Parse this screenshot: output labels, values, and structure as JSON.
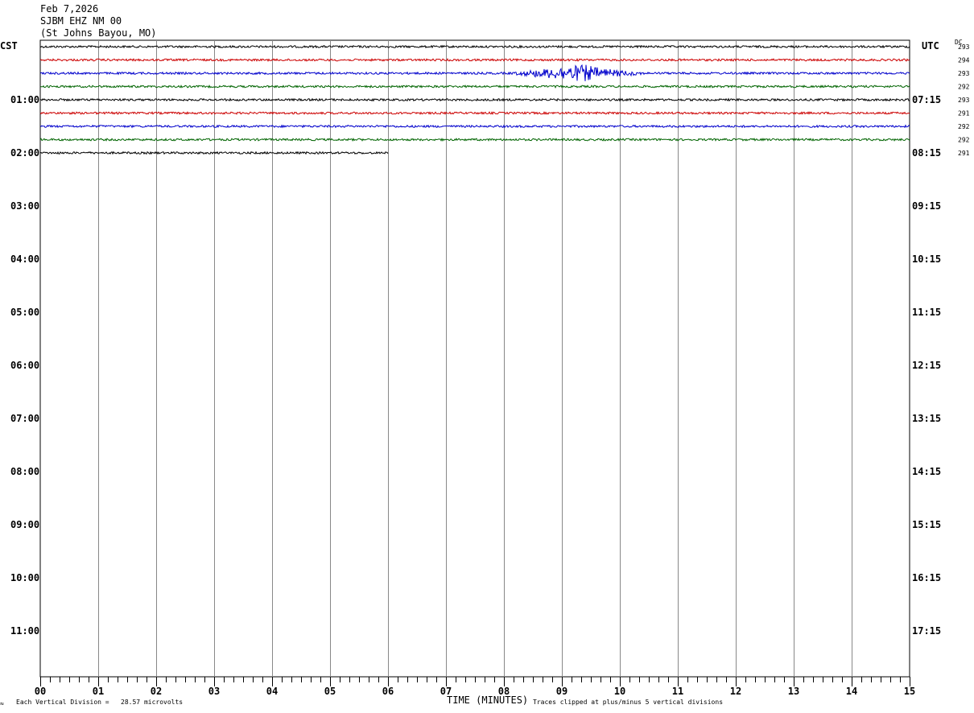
{
  "header": {
    "date": "Feb 7,2026",
    "station": "SJBM EHZ NM 00",
    "location": "(St Johns Bayou, MO)"
  },
  "left_timezone": "CST",
  "right_timezone": "UTC",
  "dc_label": "DC",
  "footer": {
    "vertical_division": "Each Vertical Division =   28.57 microvolts",
    "clip_note": "Traces clipped at plus/minus 5 vertical divisions",
    "corner_mark": "≈"
  },
  "chart_data": {
    "type": "line",
    "title": "",
    "xlabel": "TIME (MINUTES)",
    "ylabel": "",
    "xlim": [
      0,
      15
    ],
    "x_ticks": [
      "00",
      "01",
      "02",
      "03",
      "04",
      "05",
      "06",
      "07",
      "08",
      "09",
      "10",
      "11",
      "12",
      "13",
      "14",
      "15"
    ],
    "rows_per_hour": 4,
    "total_rows": 48,
    "left_hour_labels": [
      "01:00",
      "02:00",
      "03:00",
      "04:00",
      "05:00",
      "06:00",
      "07:00",
      "08:00",
      "09:00",
      "10:00",
      "11:00"
    ],
    "right_hour_labels": [
      "07:15",
      "08:15",
      "09:15",
      "10:15",
      "11:15",
      "12:15",
      "13:15",
      "14:15",
      "15:15",
      "16:15",
      "17:15"
    ],
    "trace_colors": [
      "#000000",
      "#cc0000",
      "#0000cc",
      "#006400"
    ],
    "series": [
      {
        "row": 0,
        "color": "#000000",
        "dc": "293",
        "end_minute": 15
      },
      {
        "row": 1,
        "color": "#cc0000",
        "dc": "294",
        "end_minute": 15
      },
      {
        "row": 2,
        "color": "#0000cc",
        "dc": "293",
        "end_minute": 15,
        "event": {
          "start_minute": 8.1,
          "peak_minute": 9.4,
          "end_minute": 10.4
        }
      },
      {
        "row": 3,
        "color": "#006400",
        "dc": "292",
        "end_minute": 15
      },
      {
        "row": 4,
        "color": "#000000",
        "dc": "293",
        "end_minute": 15
      },
      {
        "row": 5,
        "color": "#cc0000",
        "dc": "291",
        "end_minute": 15
      },
      {
        "row": 6,
        "color": "#0000cc",
        "dc": "292",
        "end_minute": 15
      },
      {
        "row": 7,
        "color": "#006400",
        "dc": "292",
        "end_minute": 15
      },
      {
        "row": 8,
        "color": "#000000",
        "dc": "291",
        "end_minute": 6
      }
    ]
  }
}
